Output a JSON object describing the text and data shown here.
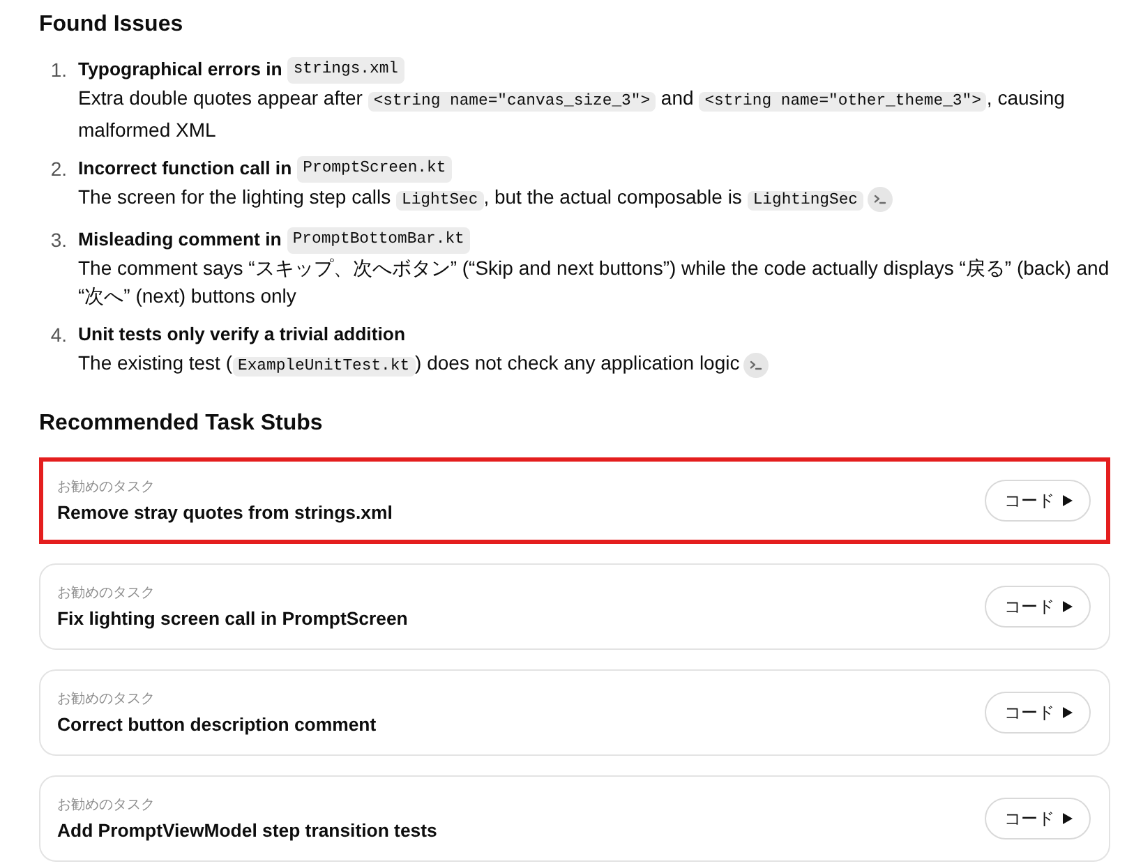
{
  "found_issues": {
    "heading": "Found Issues",
    "items": [
      {
        "number": "1.",
        "title": "Typographical errors in",
        "file": "strings.xml",
        "description": [
          {
            "kind": "text",
            "text": "Extra double quotes appear after "
          },
          {
            "kind": "code",
            "text": "<string name=\"canvas_size_3\">"
          },
          {
            "kind": "text",
            "text": " and "
          },
          {
            "kind": "code",
            "text": "<string name=\"other_theme_3\">"
          },
          {
            "kind": "text",
            "text": ", causing malformed XML"
          }
        ],
        "terminal": false
      },
      {
        "number": "2.",
        "title": "Incorrect function call in",
        "file": "PromptScreen.kt",
        "description": [
          {
            "kind": "text",
            "text": "The screen for the lighting step calls "
          },
          {
            "kind": "code",
            "text": "LightSec"
          },
          {
            "kind": "text",
            "text": ", but the actual composable is "
          },
          {
            "kind": "code",
            "text": "LightingSec"
          }
        ],
        "terminal": true
      },
      {
        "number": "3.",
        "title": "Misleading comment in",
        "file": "PromptBottomBar.kt",
        "description": [
          {
            "kind": "text",
            "text": "The comment says “スキップ、次へボタン” (“Skip and next buttons”) while the code actually displays “戻る” (back) and “次へ” (next) buttons only"
          }
        ],
        "terminal": false
      },
      {
        "number": "4.",
        "title": "Unit tests only verify a trivial addition",
        "description": [
          {
            "kind": "text",
            "text": "The existing test ("
          },
          {
            "kind": "code",
            "text": "ExampleUnitTest.kt"
          },
          {
            "kind": "text",
            "text": ") does not check any application logic"
          }
        ],
        "terminal": true
      }
    ]
  },
  "task_stubs": {
    "heading": "Recommended Task Stubs",
    "tasks": [
      {
        "label": "お勧めのタスク",
        "title": "Remove stray quotes from strings.xml",
        "button": "コード",
        "selected": true
      },
      {
        "label": "お勧めのタスク",
        "title": "Fix lighting screen call in PromptScreen",
        "button": "コード",
        "selected": false
      },
      {
        "label": "お勧めのタスク",
        "title": "Correct button description comment",
        "button": "コード",
        "selected": false
      },
      {
        "label": "お勧めのタスク",
        "title": "Add PromptViewModel step transition tests",
        "button": "コード",
        "selected": false
      }
    ]
  }
}
